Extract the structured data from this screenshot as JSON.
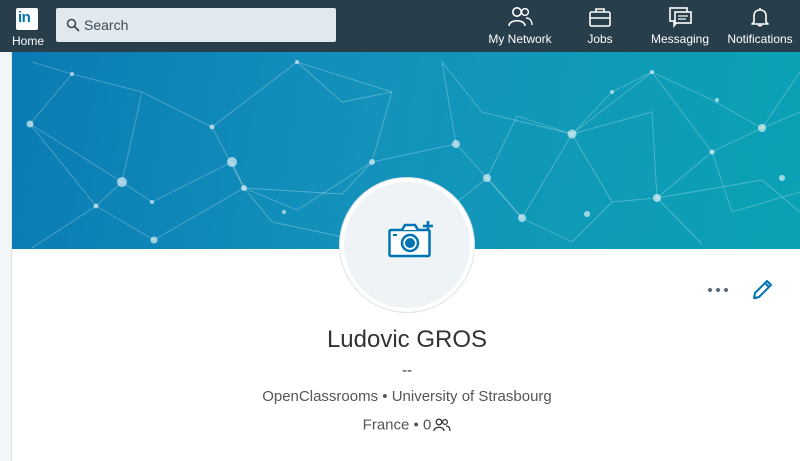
{
  "nav": {
    "logo_text": "in",
    "home_label": "Home",
    "search_placeholder": "Search",
    "items": [
      {
        "label": "My Network",
        "icon": "network-icon"
      },
      {
        "label": "Jobs",
        "icon": "briefcase-icon"
      },
      {
        "label": "Messaging",
        "icon": "messaging-icon"
      },
      {
        "label": "Notifications",
        "icon": "bell-icon"
      }
    ]
  },
  "profile": {
    "name": "Ludovic GROS",
    "headline": "--",
    "company": "OpenClassrooms",
    "school": "University of Strasbourg",
    "separator": "•",
    "location": "France",
    "connections": "0"
  },
  "colors": {
    "topbar": "#283e4a",
    "accent": "#0073b1",
    "banner": "#0a8fb8"
  }
}
